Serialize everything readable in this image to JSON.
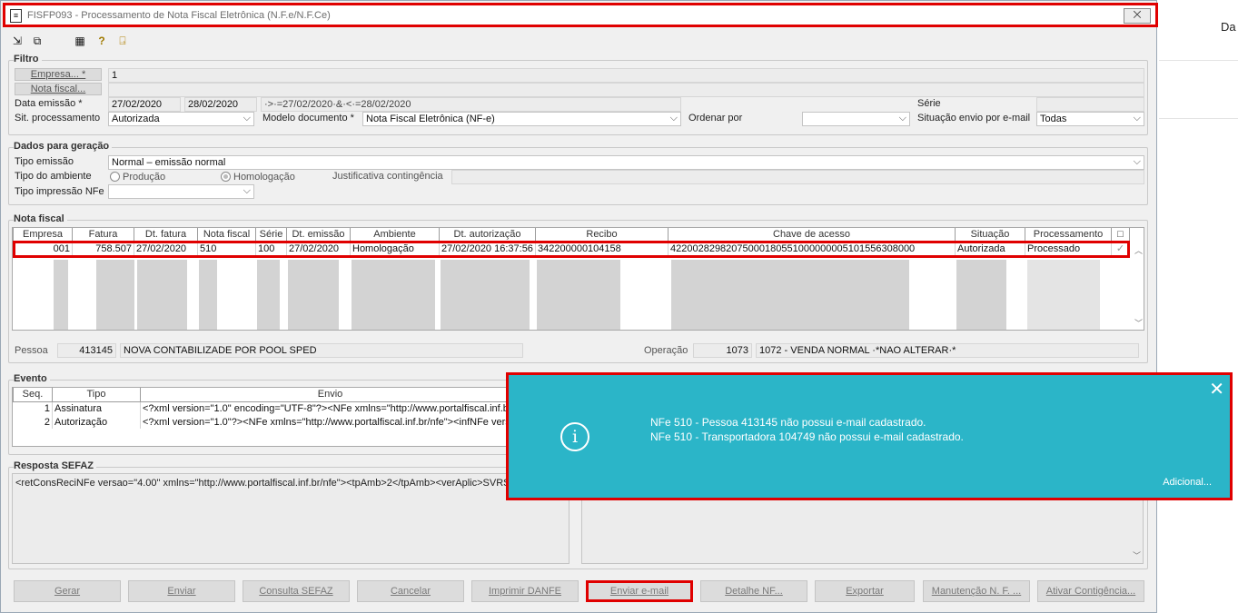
{
  "window": {
    "title": "FISFP093 - Processamento de Nota Fiscal Eletrônica (N.F.e/N.F.Ce)",
    "close": "⨉",
    "doc_icon": "≡"
  },
  "toolbar": {
    "icons": [
      "export-icon",
      "copy-icon",
      "grid-icon",
      "help-icon",
      "exit-icon"
    ],
    "glyphs": [
      "⇲",
      "⧉",
      "▦",
      "?",
      "⍈"
    ]
  },
  "filtro": {
    "title": "Filtro",
    "empresa_btn": "Empresa... *",
    "empresa_value": "1",
    "nota_btn": "Nota fiscal...",
    "data_label": "Data emissão *",
    "data_ini": "27/02/2020",
    "data_fim": "28/02/2020",
    "data_expr": "·>·=27/02/2020·&·<·=28/02/2020",
    "serie_label": "Série",
    "sit_label": "Sit. processamento",
    "sit_value": "Autorizada",
    "modelo_label": "Modelo documento *",
    "modelo_value": "Nota Fiscal Eletrônica (NF-e)",
    "ordenar_label": "Ordenar por",
    "envio_label": "Situação envio por e-mail",
    "envio_value": "Todas"
  },
  "geracao": {
    "title": "Dados para geração",
    "tipo_emissao_label": "Tipo emissão",
    "tipo_emissao_value": "Normal – emissão normal",
    "ambiente_label": "Tipo do ambiente",
    "producao": "Produção",
    "homologacao": "Homologação",
    "justificativa_label": "Justificativa contingência",
    "impressao_label": "Tipo impressão NFe"
  },
  "nota_fiscal": {
    "title": "Nota fiscal",
    "columns": [
      "Empresa",
      "Fatura",
      "Dt. fatura",
      "Nota fiscal",
      "Série",
      "Dt. emissão",
      "Ambiente",
      "Dt. autorização",
      "Recibo",
      "Chave de acesso",
      "Situação",
      "Processamento",
      "□"
    ],
    "row": [
      "001",
      "758.507",
      "27/02/2020",
      "510",
      "100",
      "27/02/2020",
      "Homologação",
      "27/02/2020 16:37:56",
      "342200000104158",
      "42200282982075000180551000000005101556308000",
      "Autorizada",
      "Processado",
      "✓"
    ]
  },
  "pessoa": {
    "label": "Pessoa",
    "code": "413145",
    "name": "NOVA CONTABILIZADE POR POOL SPED",
    "operacao_label": "Operação",
    "operacao_code": "1073",
    "operacao_desc": "1072 - VENDA NORMAL ·*NAO ALTERAR·*"
  },
  "evento": {
    "title": "Evento",
    "columns": [
      "Seq.",
      "Tipo",
      "Envio"
    ],
    "rows": [
      [
        "1",
        "Assinatura",
        "<?xml version=\"1.0\" encoding=\"UTF-8\"?><NFe xmlns=\"http://www.portalfiscal.inf.br"
      ],
      [
        "2",
        "Autorização",
        "<?xml version=\"1.0\"?><NFe xmlns=\"http://www.portalfiscal.inf.br/nfe\"><infNFe vers"
      ]
    ]
  },
  "resposta": {
    "title": "Resposta SEFAZ",
    "text": "<retConsReciNFe versao=\"4.00\" xmlns=\"http://www.portalfiscal.inf.br/nfe\"><tpAmb>2</tpAmb><verAplic>SVRS"
  },
  "buttons": [
    "Gerar",
    "Enviar",
    "Consulta SEFAZ",
    "Cancelar",
    "Imprimir DANFE",
    "Enviar e-mail",
    "Detalhe NF...",
    "Exportar",
    "Manutenção N. F. ...",
    "Ativar Contigência..."
  ],
  "toast": {
    "line1": "NFe 510 - Pessoa 413145 não possui e-mail cadastrado.",
    "line2": "NFe 510 - Transportadora 104749 não possui e-mail cadastrado.",
    "more": "Adicional...",
    "close": "✕",
    "info": "i"
  },
  "background": {
    "right_text": "Da"
  },
  "colors": {
    "toast": "#2bb5c8",
    "highlight": "#e00000"
  }
}
